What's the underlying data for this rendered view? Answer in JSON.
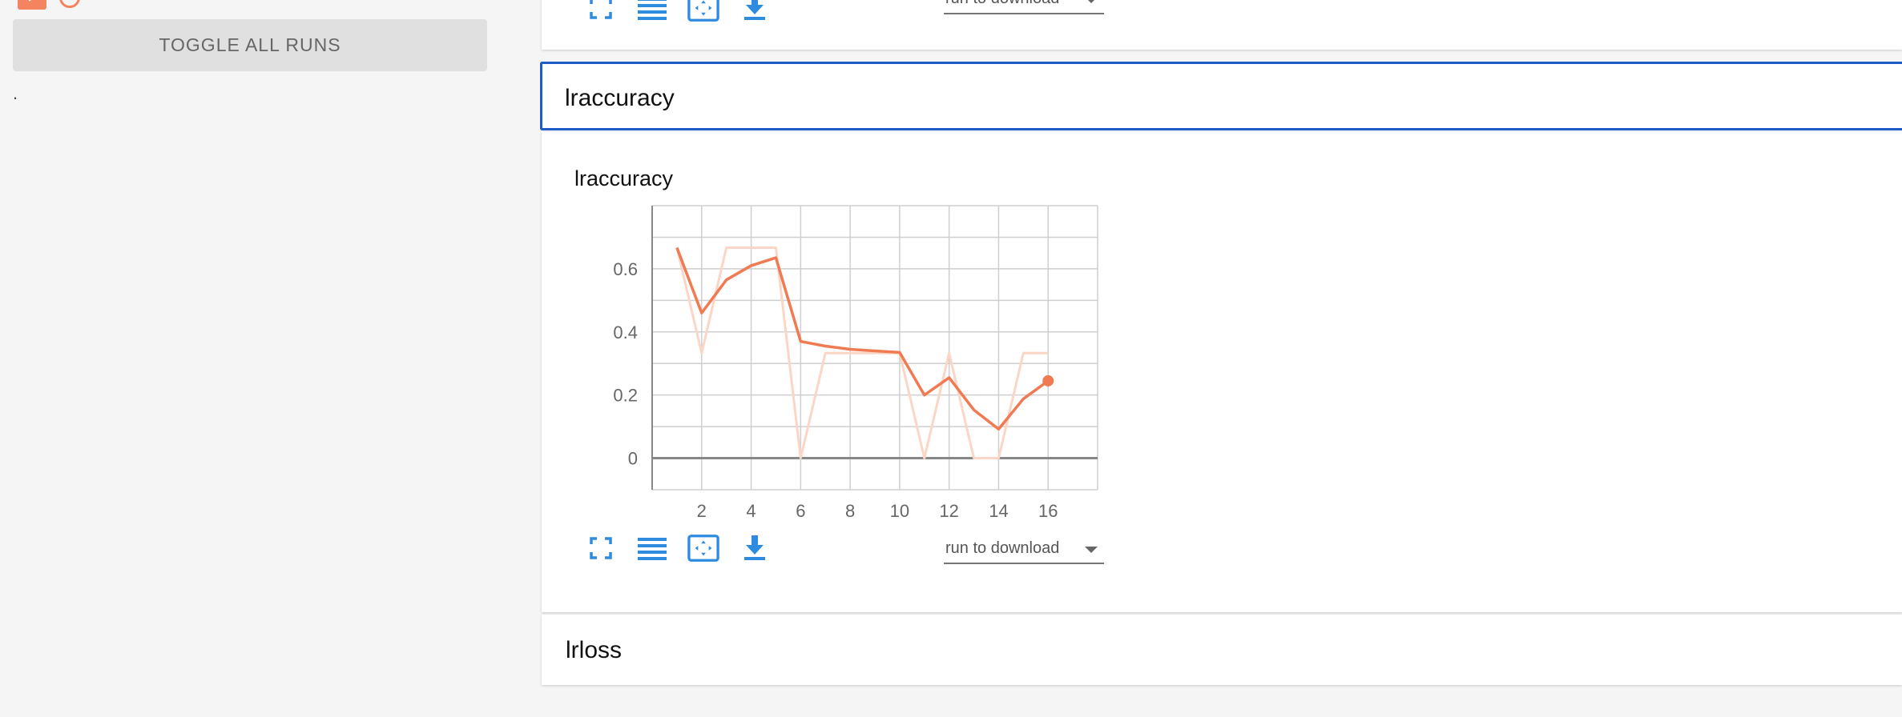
{
  "sidebar": {
    "run_name": "·",
    "toggle_all_label": "TOGGLE ALL RUNS",
    "footnote": "."
  },
  "top_card": {
    "run_select": {
      "label": "run to download"
    }
  },
  "section": {
    "title": "lraccuracy"
  },
  "lr_card": {
    "run_select": {
      "label": "run to download"
    },
    "icons": [
      "fullscreen-icon",
      "data-table-icon",
      "fit-domain-icon",
      "download-icon"
    ]
  },
  "loss_section": {
    "title": "lrloss"
  },
  "colors": {
    "accent": "#1e5bc6",
    "series": "#f07a52",
    "series_raw": "#fbd5c6",
    "icon_blue": "#2f8be0"
  },
  "chart_data": {
    "type": "line",
    "title": "lraccuracy",
    "xlabel": "",
    "ylabel": "",
    "xlim": [
      0,
      18
    ],
    "ylim": [
      -0.1,
      0.8
    ],
    "grid": true,
    "x_ticks": [
      2,
      4,
      6,
      8,
      10,
      12,
      14,
      16
    ],
    "y_ticks": [
      0,
      0.2,
      0.4,
      0.6
    ],
    "y_tick_labels": [
      "0",
      "0.2",
      "0.4",
      "0.6"
    ],
    "series": [
      {
        "kind": "raw",
        "x": [
          1,
          2,
          3,
          4,
          5,
          6,
          7,
          8,
          9,
          10,
          11,
          12,
          13,
          14,
          15,
          16
        ],
        "values": [
          0.667,
          0.333,
          0.667,
          0.667,
          0.667,
          0,
          0.333,
          0.333,
          0.333,
          0.333,
          0,
          0.333,
          0,
          0,
          0.333,
          0.333
        ]
      },
      {
        "kind": "smoothed",
        "x": [
          1,
          2,
          3,
          4,
          5,
          6,
          7,
          8,
          9,
          10,
          11,
          12,
          13,
          14,
          15,
          16
        ],
        "values": [
          0.667,
          0.46,
          0.565,
          0.61,
          0.635,
          0.37,
          0.355,
          0.345,
          0.34,
          0.335,
          0.2,
          0.255,
          0.153,
          0.092,
          0.188,
          0.245
        ]
      }
    ]
  }
}
